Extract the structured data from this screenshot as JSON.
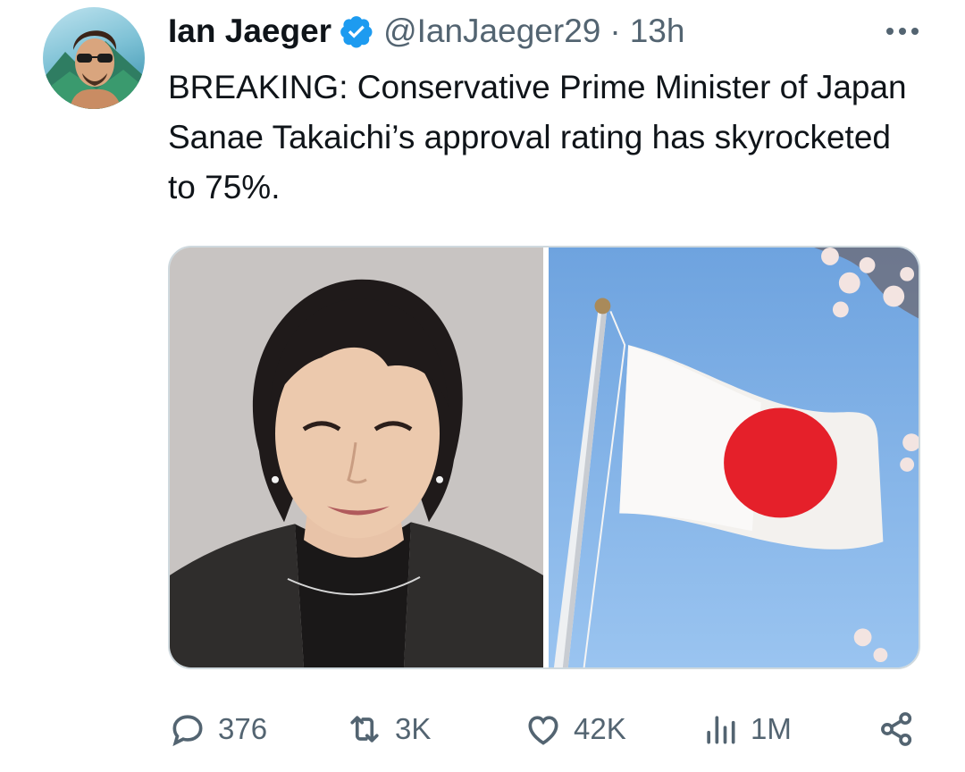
{
  "tweet": {
    "author": {
      "display_name": "Ian Jaeger",
      "handle": "@IanJaeger29",
      "verified": true,
      "verified_color": "#1d9bf0"
    },
    "separator": "·",
    "time": "13h",
    "text": "BREAKING: Conservative Prime Minister of Japan Sanae Takaichi’s approval rating has skyrocketed to 75%.",
    "media": [
      {
        "icon": "portrait-photo"
      },
      {
        "icon": "japanese-flag-photo"
      }
    ]
  },
  "actions": {
    "replies": {
      "icon": "reply-icon",
      "count": "376"
    },
    "reposts": {
      "icon": "repost-icon",
      "count": "3K"
    },
    "likes": {
      "icon": "like-icon",
      "count": "42K"
    },
    "views": {
      "icon": "views-icon",
      "count": "1M"
    },
    "share": {
      "icon": "share-icon"
    }
  },
  "colors": {
    "text": "#0f1419",
    "secondary": "#536471",
    "accent": "#1d9bf0",
    "flag_red": "#e5202a"
  }
}
